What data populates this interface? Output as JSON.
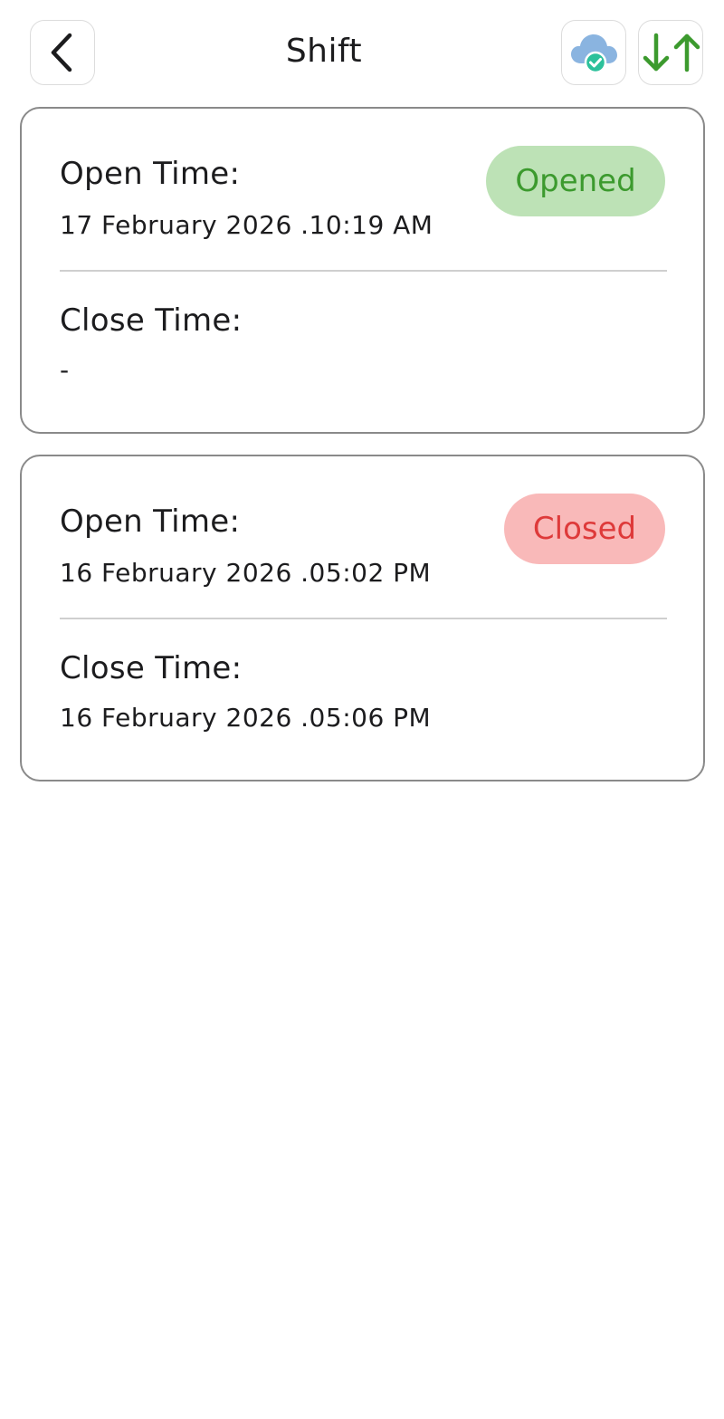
{
  "header": {
    "title": "Shift",
    "back_icon": "chevron-left-icon",
    "sync_icon": "cloud-check-icon",
    "sort_icon": "sort-arrows-icon"
  },
  "shifts": [
    {
      "open_label": "Open Time:",
      "open_time": "17 February 2026 .10:19 AM",
      "close_label": "Close Time:",
      "close_time": "-",
      "status": "Opened"
    },
    {
      "open_label": "Open Time:",
      "open_time": "16 February 2026 .05:02 PM",
      "close_label": "Close Time:",
      "close_time": "16 February 2026 .05:06 PM",
      "status": "Closed"
    }
  ],
  "colors": {
    "opened_bg": "#bde2b6",
    "opened_text": "#3c9a2e",
    "closed_bg": "#f9b9b9",
    "closed_text": "#de3a3a",
    "sort_arrows": "#3c9a2e",
    "cloud": "#8ab4e0",
    "check": "#2cc19b"
  }
}
